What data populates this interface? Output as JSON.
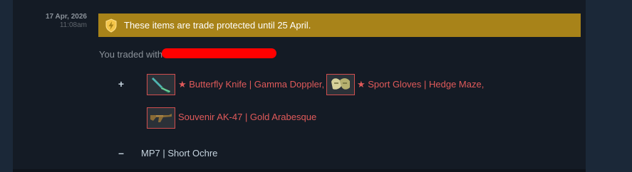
{
  "entry": {
    "date": "17 Apr, 2026",
    "time": "11:08am"
  },
  "banner": {
    "icon": "lightning-shield-icon",
    "text": "These items are trade protected until 25 April.",
    "color": "#a88319"
  },
  "trade": {
    "traded_with_label": "You traded with"
  },
  "received": {
    "sign": "+",
    "items": [
      {
        "name": "★ Butterfly Knife | Gamma Doppler,",
        "icon": "butterfly-knife-icon"
      },
      {
        "name": "★ Sport Gloves | Hedge Maze,",
        "icon": "sport-gloves-icon"
      },
      {
        "name": "Souvenir AK-47 | Gold Arabesque",
        "icon": "ak47-icon"
      }
    ],
    "name_color": "#e05a5a"
  },
  "given": {
    "sign": "–",
    "items": [
      {
        "name": "MP7 | Short Ochre"
      }
    ]
  }
}
